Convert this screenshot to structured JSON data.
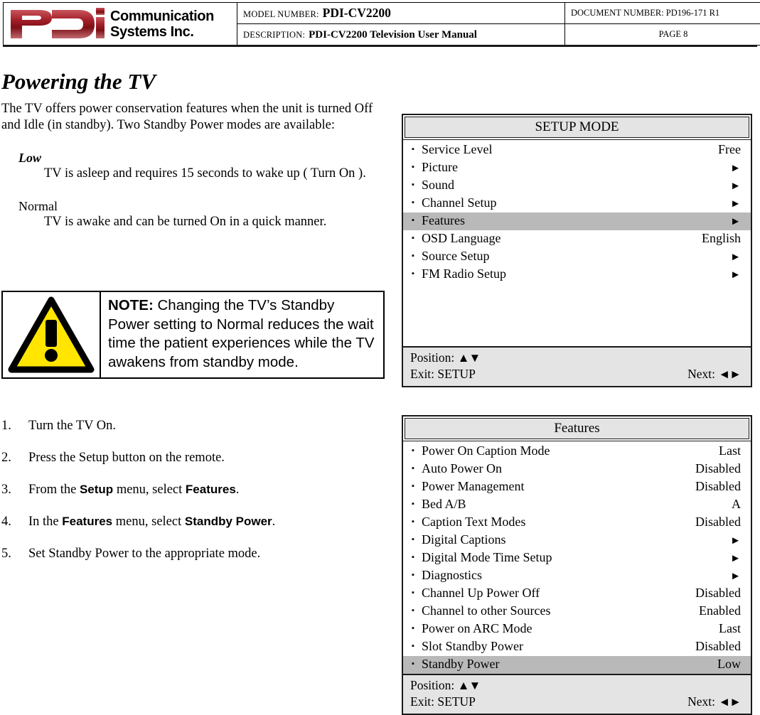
{
  "header": {
    "logo": {
      "mark_text": "PDI",
      "company_line1": "Communication",
      "company_line2": "Systems Inc.",
      "brand_color": "#9e1b22"
    },
    "model_label": "MODEL NUMBER:",
    "model_value": "PDI-CV2200",
    "description_label": "DESCRIPTION:",
    "description_value": "PDI-CV2200 Television User Manual",
    "document_number": "DOCUMENT NUMBER:  PD196-171 R1",
    "page": "PAGE 8"
  },
  "content": {
    "title": "Powering the TV",
    "intro": "The TV offers power conservation features when the unit is turned Off and Idle (in standby).  Two Standby Power modes are available:",
    "modes": [
      {
        "term": "Low",
        "definition": "TV is asleep and requires 15 seconds to wake up ( Turn On )."
      },
      {
        "term": "Normal",
        "definition": "TV is awake and can be turned On in a quick manner."
      }
    ],
    "note": {
      "label": "NOTE:",
      "text": "Changing the TV’s Standby Power setting to Normal reduces the wait time the patient experiences while the TV awakens from standby mode.",
      "icon_fill": "#FFE500",
      "icon_stroke": "#000000"
    },
    "steps": [
      {
        "num": "1.",
        "pre": "Turn the TV On.",
        "ui1": "",
        "mid": "",
        "ui2": "",
        "post": ""
      },
      {
        "num": "2.",
        "pre": "Press the Setup button on the remote.",
        "ui1": "",
        "mid": "",
        "ui2": "",
        "post": ""
      },
      {
        "num": "3.",
        "pre": "From the ",
        "ui1": "Setup",
        "mid": " menu, select ",
        "ui2": "Features",
        "post": "."
      },
      {
        "num": "4.",
        "pre": "In the ",
        "ui1": "Features",
        "mid": " menu, select ",
        "ui2": "Standby Power",
        "post": "."
      },
      {
        "num": "5.",
        "pre": "Set Standby Power to the appropriate mode.",
        "ui1": "",
        "mid": "",
        "ui2": "",
        "post": ""
      }
    ]
  },
  "osd_setup": {
    "title": "SETUP MODE",
    "highlight_color": "#b9b9b9",
    "rows": [
      {
        "label": "Service Level",
        "value": "Free",
        "is_arrow": false,
        "highlighted": false
      },
      {
        "label": "Picture",
        "value": "►",
        "is_arrow": true,
        "highlighted": false
      },
      {
        "label": "Sound",
        "value": "►",
        "is_arrow": true,
        "highlighted": false
      },
      {
        "label": "Channel Setup",
        "value": "►",
        "is_arrow": true,
        "highlighted": false
      },
      {
        "label": "Features",
        "value": "►",
        "is_arrow": true,
        "highlighted": true
      },
      {
        "label": "OSD Language",
        "value": "English",
        "is_arrow": false,
        "highlighted": false
      },
      {
        "label": "Source Setup",
        "value": "►",
        "is_arrow": true,
        "highlighted": false
      },
      {
        "label": "FM Radio Setup",
        "value": "►",
        "is_arrow": true,
        "highlighted": false
      }
    ],
    "filler_rows": 4,
    "footer": {
      "position_label": "Position:",
      "position_glyph": "▲▼",
      "exit_label": "Exit: SETUP",
      "next_label": "Next:",
      "next_glyph": "◄►"
    }
  },
  "osd_features": {
    "title": "Features",
    "highlight_color": "#b9b9b9",
    "rows": [
      {
        "label": "Power On Caption Mode",
        "value": "Last",
        "is_arrow": false,
        "highlighted": false
      },
      {
        "label": "Auto Power On",
        "value": "Disabled",
        "is_arrow": false,
        "highlighted": false
      },
      {
        "label": "Power Management",
        "value": "Disabled",
        "is_arrow": false,
        "highlighted": false
      },
      {
        "label": "Bed A/B",
        "value": "A",
        "is_arrow": false,
        "highlighted": false
      },
      {
        "label": "Caption Text Modes",
        "value": "Disabled",
        "is_arrow": false,
        "highlighted": false
      },
      {
        "label": "Digital Captions",
        "value": "►",
        "is_arrow": true,
        "highlighted": false
      },
      {
        "label": "Digital Mode Time Setup",
        "value": "►",
        "is_arrow": true,
        "highlighted": false
      },
      {
        "label": "Diagnostics",
        "value": "►",
        "is_arrow": true,
        "highlighted": false
      },
      {
        "label": "Channel Up Power Off",
        "value": "Disabled",
        "is_arrow": false,
        "highlighted": false
      },
      {
        "label": "Channel to other Sources",
        "value": "Enabled",
        "is_arrow": false,
        "highlighted": false
      },
      {
        "label": "Power on ARC Mode",
        "value": "Last",
        "is_arrow": false,
        "highlighted": false
      },
      {
        "label": "Slot Standby Power",
        "value": "Disabled",
        "is_arrow": false,
        "highlighted": false
      },
      {
        "label": "Standby Power",
        "value": "Low",
        "is_arrow": false,
        "highlighted": true
      }
    ],
    "filler_rows": 0,
    "footer": {
      "position_label": "Position:",
      "position_glyph": "▲▼",
      "exit_label": "Exit: SETUP",
      "next_label": "Next:",
      "next_glyph": "◄►"
    }
  }
}
